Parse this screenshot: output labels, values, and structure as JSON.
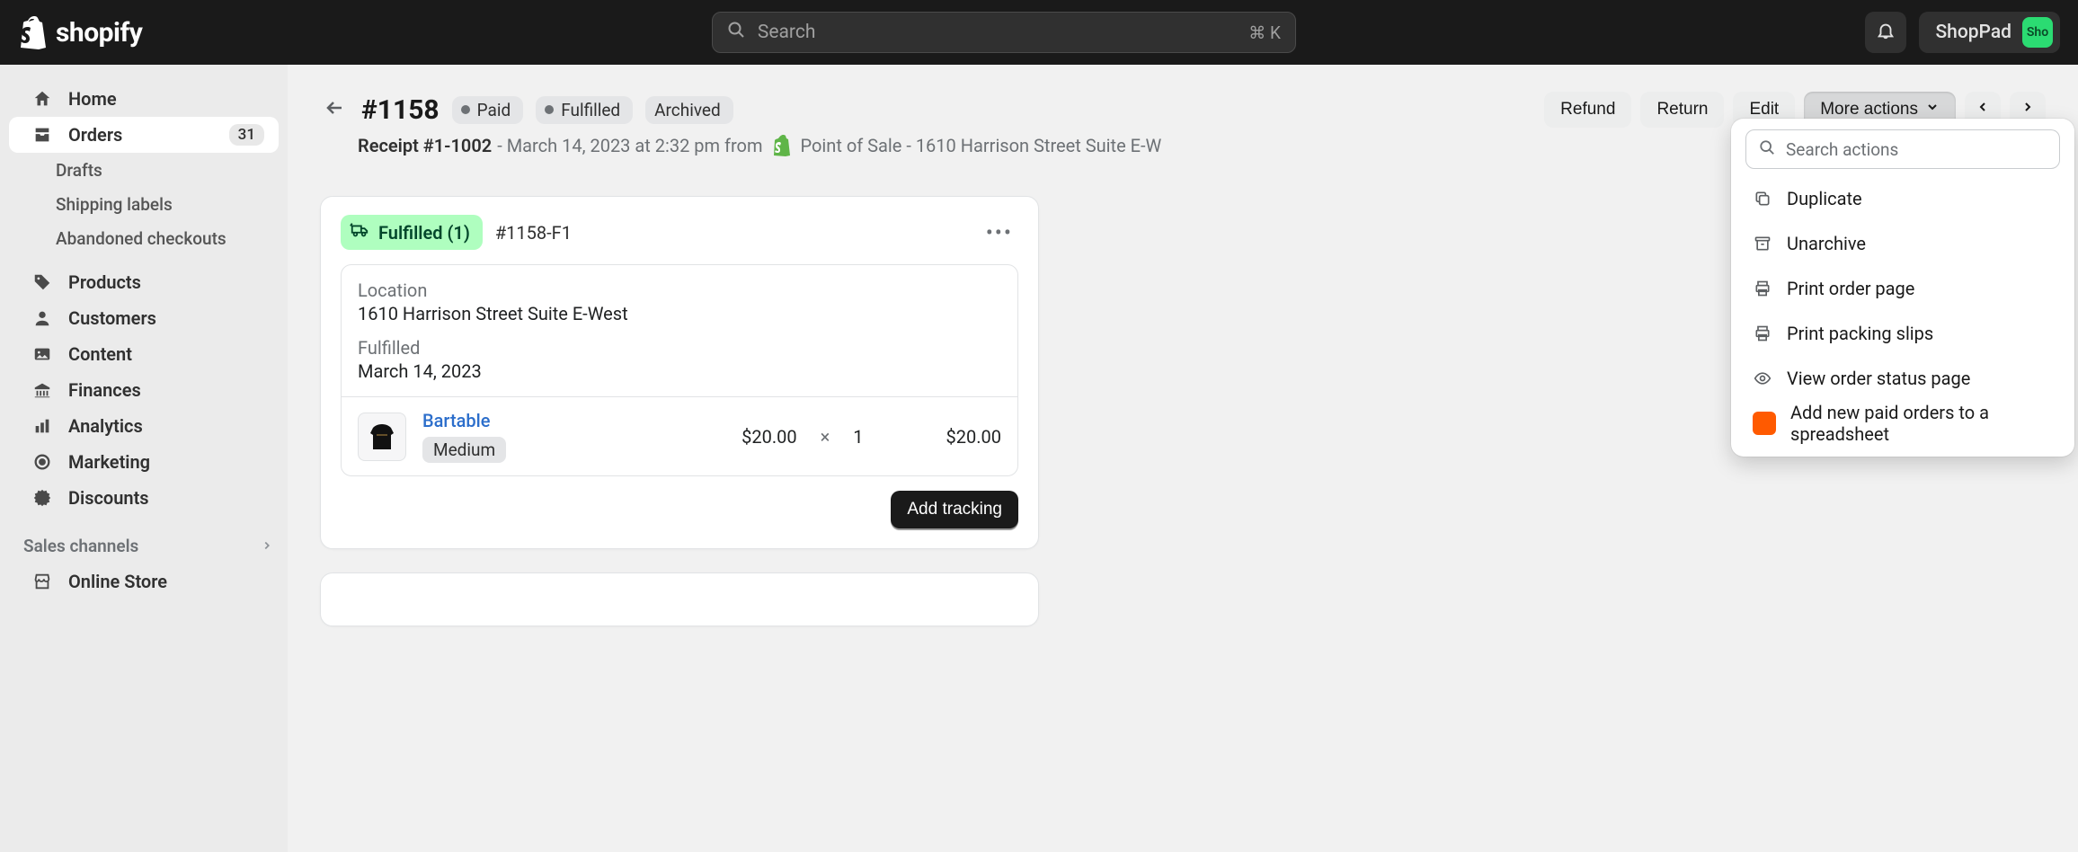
{
  "topbar": {
    "brand": "shopify",
    "search_placeholder": "Search",
    "search_shortcut": "⌘ K",
    "account_name": "ShopPad",
    "avatar_initials": "Sho"
  },
  "sidebar": {
    "home": "Home",
    "orders": "Orders",
    "orders_count": "31",
    "drafts": "Drafts",
    "shipping_labels": "Shipping labels",
    "abandoned": "Abandoned checkouts",
    "products": "Products",
    "customers": "Customers",
    "content": "Content",
    "finances": "Finances",
    "analytics": "Analytics",
    "marketing": "Marketing",
    "discounts": "Discounts",
    "sales_channels": "Sales channels",
    "online_store": "Online Store"
  },
  "header": {
    "order_title": "#1158",
    "pill_paid": "Paid",
    "pill_fulfilled": "Fulfilled",
    "pill_archived": "Archived",
    "actions": {
      "refund": "Refund",
      "return": "Return",
      "edit": "Edit",
      "more": "More actions"
    },
    "receipt_label": "Receipt #1-1002",
    "receipt_meta": " - March 14, 2023 at 2:32 pm from ",
    "pos_text": " Point of Sale - 1610 Harrison Street Suite E-W"
  },
  "fulfillment": {
    "badge": "Fulfilled (1)",
    "id": "#1158-F1",
    "location_label": "Location",
    "location_value": "1610 Harrison Street Suite E-West",
    "fulfilled_label": "Fulfilled",
    "fulfilled_date": "March 14, 2023",
    "item": {
      "title": "Bartable",
      "variant": "Medium",
      "unit_price": "$20.00",
      "multiply": "×",
      "qty": "1",
      "line_total": "$20.00"
    },
    "add_tracking": "Add tracking"
  },
  "popover": {
    "search_placeholder": "Search actions",
    "items": {
      "duplicate": "Duplicate",
      "unarchive": "Unarchive",
      "print_order": "Print order page",
      "print_packing": "Print packing slips",
      "view_status": "View order status page",
      "add_spreadsheet": "Add new paid orders to a spreadsheet"
    }
  }
}
